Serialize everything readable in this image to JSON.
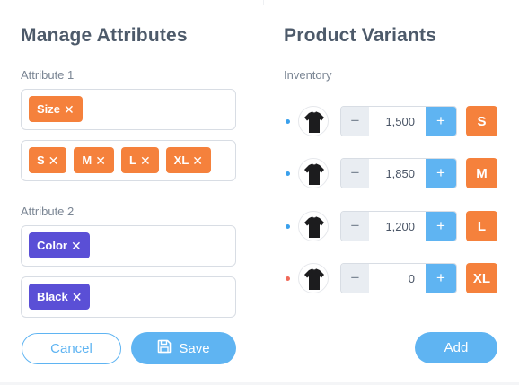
{
  "left": {
    "title": "Manage Attributes",
    "attribute1": {
      "label": "Attribute 1",
      "name_tags": [
        {
          "label": "Size"
        }
      ],
      "value_tags": [
        {
          "label": "S"
        },
        {
          "label": "M"
        },
        {
          "label": "L"
        },
        {
          "label": "XL"
        }
      ]
    },
    "attribute2": {
      "label": "Attribute 2",
      "name_tags": [
        {
          "label": "Color"
        }
      ],
      "value_tags": [
        {
          "label": "Black"
        }
      ]
    },
    "cancel_label": "Cancel",
    "save_label": "Save"
  },
  "right": {
    "title": "Product Variants",
    "inventory_label": "Inventory",
    "variants": [
      {
        "qty": "1,500",
        "size": "S",
        "status_color": "#3aa0ec"
      },
      {
        "qty": "1,850",
        "size": "M",
        "status_color": "#3aa0ec"
      },
      {
        "qty": "1,200",
        "size": "L",
        "status_color": "#3aa0ec"
      },
      {
        "qty": "0",
        "size": "XL",
        "status_color": "#f06a5a"
      }
    ],
    "minus_symbol": "−",
    "plus_symbol": "+",
    "add_label": "Add"
  },
  "colors": {
    "accent_blue": "#5fb4f2",
    "tag_orange": "#f5813c",
    "tag_purple": "#5a4fd6"
  },
  "icons": {
    "tag_remove": "close-icon",
    "save": "floppy-disk-icon",
    "variant_image": "black-tshirt-icon"
  }
}
